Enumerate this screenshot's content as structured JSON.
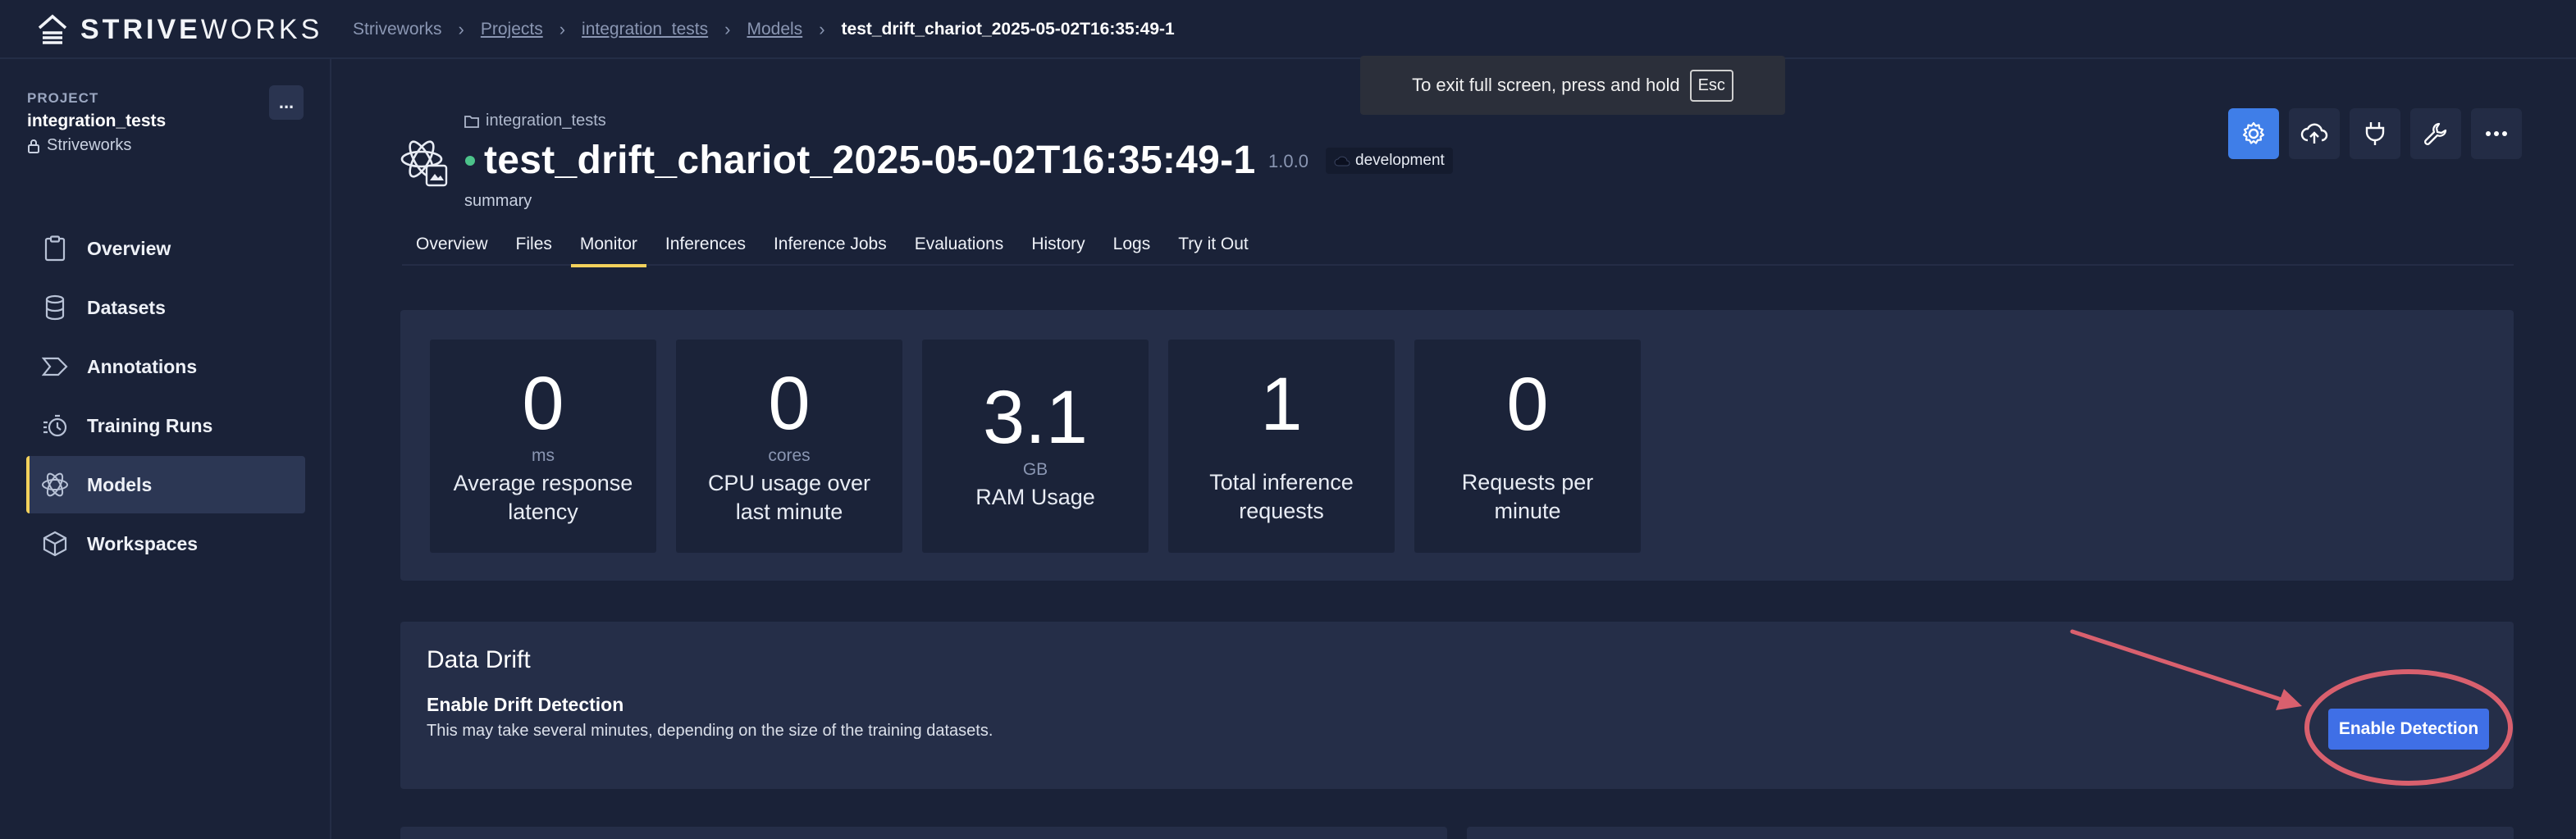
{
  "brand": {
    "prefix": "STRIVE",
    "suffix": "WORKS"
  },
  "breadcrumbs": [
    {
      "label": "Striveworks",
      "link": false
    },
    {
      "label": "Projects",
      "link": true
    },
    {
      "label": "integration_tests",
      "link": true
    },
    {
      "label": "Models",
      "link": true
    },
    {
      "label": "test_drift_chariot_2025-05-02T16:35:49-1",
      "link": false
    }
  ],
  "sidebar": {
    "project_label": "PROJECT",
    "project_name": "integration_tests",
    "project_org": "Striveworks",
    "menu_label": "...",
    "items": [
      {
        "label": "Overview",
        "icon": "clipboard-icon",
        "active": false
      },
      {
        "label": "Datasets",
        "icon": "database-icon",
        "active": false
      },
      {
        "label": "Annotations",
        "icon": "annotation-icon",
        "active": false
      },
      {
        "label": "Training Runs",
        "icon": "timer-icon",
        "active": false
      },
      {
        "label": "Models",
        "icon": "atom-icon",
        "active": true
      },
      {
        "label": "Workspaces",
        "icon": "cube-icon",
        "active": false
      }
    ]
  },
  "fullscreen_notice": {
    "text": "To exit full screen, press and hold",
    "key": "Esc"
  },
  "model": {
    "folder": "integration_tests",
    "title": "test_drift_chariot_2025-05-02T16:35:49-1",
    "version": "1.0.0",
    "environment": "development",
    "summary": "summary",
    "status_color": "#4cc38a"
  },
  "tabs": [
    {
      "label": "Overview",
      "active": false
    },
    {
      "label": "Files",
      "active": false
    },
    {
      "label": "Monitor",
      "active": true
    },
    {
      "label": "Inferences",
      "active": false
    },
    {
      "label": "Inference Jobs",
      "active": false
    },
    {
      "label": "Evaluations",
      "active": false
    },
    {
      "label": "History",
      "active": false
    },
    {
      "label": "Logs",
      "active": false
    },
    {
      "label": "Try it Out",
      "active": false
    }
  ],
  "metrics": [
    {
      "value": "0",
      "unit": "ms",
      "label": "Average response latency"
    },
    {
      "value": "0",
      "unit": "cores",
      "label": "CPU usage over last minute"
    },
    {
      "value": "3.1",
      "unit": "GB",
      "label": "RAM Usage"
    },
    {
      "value": "1",
      "unit": "",
      "label": "Total inference requests"
    },
    {
      "value": "0",
      "unit": "",
      "label": "Requests per minute"
    }
  ],
  "drift": {
    "title": "Data Drift",
    "subtitle": "Enable Drift Detection",
    "description": "This may take several minutes, depending on the size of the training datasets.",
    "button_label": "Enable Detection"
  },
  "colors": {
    "accent": "#3f7ee8",
    "tab_underline": "#f3d15c",
    "annotation": "#d9606e"
  }
}
